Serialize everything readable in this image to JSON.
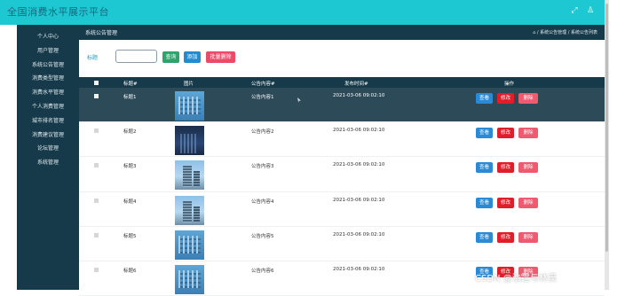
{
  "app": {
    "title": "全国消费水平展示平台"
  },
  "colors": {
    "topbar": "#1ec8d3",
    "sidebar": "#163a4a",
    "view": "#2a8ad6",
    "edit": "#e11d2a",
    "delete": "#ee5a6f",
    "query": "#2ea36b",
    "add": "#238ccf"
  },
  "topbar_icons": [
    "fullscreen-icon",
    "user-icon"
  ],
  "sidebar": {
    "items": [
      {
        "label": "个人中心"
      },
      {
        "label": "用户管理"
      },
      {
        "label": "系统公告管理"
      },
      {
        "label": "消费类型管理"
      },
      {
        "label": "消费水平管理"
      },
      {
        "label": "个人消费管理"
      },
      {
        "label": "城市排名管理"
      },
      {
        "label": "消费建议管理"
      },
      {
        "label": "论坛管理"
      },
      {
        "label": "系统管理"
      }
    ]
  },
  "header": {
    "page_title": "系统公告管理",
    "breadcrumb": "/ 系统公告管理 / 系统公告列表"
  },
  "search": {
    "label": "标题",
    "value": "",
    "query_label": "查询",
    "add_label": "添加",
    "batch_delete_label": "批量删除"
  },
  "table": {
    "columns": [
      "标题#",
      "图片",
      "公告内容#",
      "发布时间#",
      "操作"
    ],
    "rows": [
      {
        "title": "标题1",
        "image": "shot",
        "content": "公告内容1",
        "time": "2021-03-06 09:02:10",
        "selected": true
      },
      {
        "title": "标题2",
        "image": "night",
        "content": "公告内容2",
        "time": "2021-03-06 09:02:10",
        "selected": false
      },
      {
        "title": "标题3",
        "image": "day",
        "content": "公告内容3",
        "time": "2021-03-06 09:02:10",
        "selected": false
      },
      {
        "title": "标题4",
        "image": "day",
        "content": "公告内容4",
        "time": "2021-03-06 09:02:10",
        "selected": false
      },
      {
        "title": "标题5",
        "image": "shot",
        "content": "公告内容5",
        "time": "2021-03-06 09:02:10",
        "selected": false
      },
      {
        "title": "标题6",
        "image": "shot",
        "content": "公告内容6",
        "time": "2021-03-06 09:02:10",
        "selected": false
      }
    ],
    "actions": {
      "view": "查看",
      "edit": "修改",
      "delete": "删除"
    }
  },
  "watermark": "CSDN @浩霆与林漠"
}
